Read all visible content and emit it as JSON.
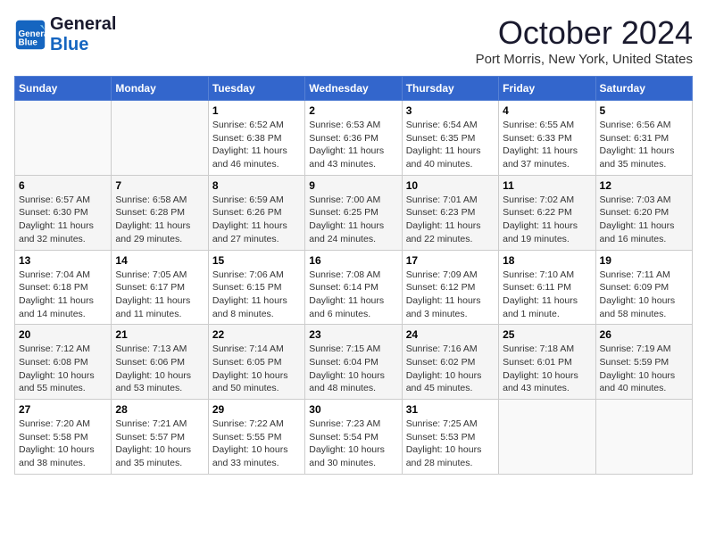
{
  "header": {
    "logo_general": "General",
    "logo_blue": "Blue",
    "title": "October 2024",
    "location": "Port Morris, New York, United States"
  },
  "weekdays": [
    "Sunday",
    "Monday",
    "Tuesday",
    "Wednesday",
    "Thursday",
    "Friday",
    "Saturday"
  ],
  "weeks": [
    [
      {
        "day": "",
        "info": ""
      },
      {
        "day": "",
        "info": ""
      },
      {
        "day": "1",
        "info": "Sunrise: 6:52 AM\nSunset: 6:38 PM\nDaylight: 11 hours and 46 minutes."
      },
      {
        "day": "2",
        "info": "Sunrise: 6:53 AM\nSunset: 6:36 PM\nDaylight: 11 hours and 43 minutes."
      },
      {
        "day": "3",
        "info": "Sunrise: 6:54 AM\nSunset: 6:35 PM\nDaylight: 11 hours and 40 minutes."
      },
      {
        "day": "4",
        "info": "Sunrise: 6:55 AM\nSunset: 6:33 PM\nDaylight: 11 hours and 37 minutes."
      },
      {
        "day": "5",
        "info": "Sunrise: 6:56 AM\nSunset: 6:31 PM\nDaylight: 11 hours and 35 minutes."
      }
    ],
    [
      {
        "day": "6",
        "info": "Sunrise: 6:57 AM\nSunset: 6:30 PM\nDaylight: 11 hours and 32 minutes."
      },
      {
        "day": "7",
        "info": "Sunrise: 6:58 AM\nSunset: 6:28 PM\nDaylight: 11 hours and 29 minutes."
      },
      {
        "day": "8",
        "info": "Sunrise: 6:59 AM\nSunset: 6:26 PM\nDaylight: 11 hours and 27 minutes."
      },
      {
        "day": "9",
        "info": "Sunrise: 7:00 AM\nSunset: 6:25 PM\nDaylight: 11 hours and 24 minutes."
      },
      {
        "day": "10",
        "info": "Sunrise: 7:01 AM\nSunset: 6:23 PM\nDaylight: 11 hours and 22 minutes."
      },
      {
        "day": "11",
        "info": "Sunrise: 7:02 AM\nSunset: 6:22 PM\nDaylight: 11 hours and 19 minutes."
      },
      {
        "day": "12",
        "info": "Sunrise: 7:03 AM\nSunset: 6:20 PM\nDaylight: 11 hours and 16 minutes."
      }
    ],
    [
      {
        "day": "13",
        "info": "Sunrise: 7:04 AM\nSunset: 6:18 PM\nDaylight: 11 hours and 14 minutes."
      },
      {
        "day": "14",
        "info": "Sunrise: 7:05 AM\nSunset: 6:17 PM\nDaylight: 11 hours and 11 minutes."
      },
      {
        "day": "15",
        "info": "Sunrise: 7:06 AM\nSunset: 6:15 PM\nDaylight: 11 hours and 8 minutes."
      },
      {
        "day": "16",
        "info": "Sunrise: 7:08 AM\nSunset: 6:14 PM\nDaylight: 11 hours and 6 minutes."
      },
      {
        "day": "17",
        "info": "Sunrise: 7:09 AM\nSunset: 6:12 PM\nDaylight: 11 hours and 3 minutes."
      },
      {
        "day": "18",
        "info": "Sunrise: 7:10 AM\nSunset: 6:11 PM\nDaylight: 11 hours and 1 minute."
      },
      {
        "day": "19",
        "info": "Sunrise: 7:11 AM\nSunset: 6:09 PM\nDaylight: 10 hours and 58 minutes."
      }
    ],
    [
      {
        "day": "20",
        "info": "Sunrise: 7:12 AM\nSunset: 6:08 PM\nDaylight: 10 hours and 55 minutes."
      },
      {
        "day": "21",
        "info": "Sunrise: 7:13 AM\nSunset: 6:06 PM\nDaylight: 10 hours and 53 minutes."
      },
      {
        "day": "22",
        "info": "Sunrise: 7:14 AM\nSunset: 6:05 PM\nDaylight: 10 hours and 50 minutes."
      },
      {
        "day": "23",
        "info": "Sunrise: 7:15 AM\nSunset: 6:04 PM\nDaylight: 10 hours and 48 minutes."
      },
      {
        "day": "24",
        "info": "Sunrise: 7:16 AM\nSunset: 6:02 PM\nDaylight: 10 hours and 45 minutes."
      },
      {
        "day": "25",
        "info": "Sunrise: 7:18 AM\nSunset: 6:01 PM\nDaylight: 10 hours and 43 minutes."
      },
      {
        "day": "26",
        "info": "Sunrise: 7:19 AM\nSunset: 5:59 PM\nDaylight: 10 hours and 40 minutes."
      }
    ],
    [
      {
        "day": "27",
        "info": "Sunrise: 7:20 AM\nSunset: 5:58 PM\nDaylight: 10 hours and 38 minutes."
      },
      {
        "day": "28",
        "info": "Sunrise: 7:21 AM\nSunset: 5:57 PM\nDaylight: 10 hours and 35 minutes."
      },
      {
        "day": "29",
        "info": "Sunrise: 7:22 AM\nSunset: 5:55 PM\nDaylight: 10 hours and 33 minutes."
      },
      {
        "day": "30",
        "info": "Sunrise: 7:23 AM\nSunset: 5:54 PM\nDaylight: 10 hours and 30 minutes."
      },
      {
        "day": "31",
        "info": "Sunrise: 7:25 AM\nSunset: 5:53 PM\nDaylight: 10 hours and 28 minutes."
      },
      {
        "day": "",
        "info": ""
      },
      {
        "day": "",
        "info": ""
      }
    ]
  ]
}
